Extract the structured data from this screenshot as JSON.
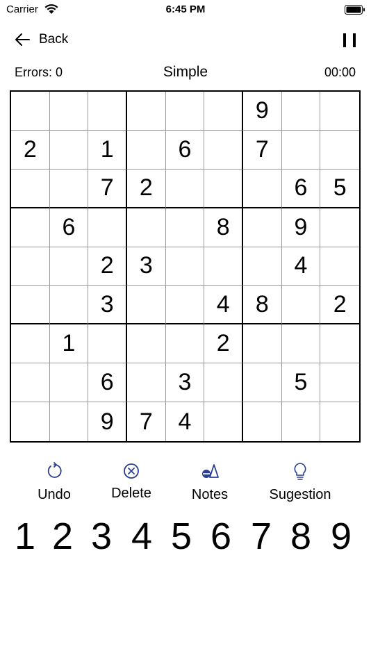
{
  "status": {
    "carrier": "Carrier",
    "time": "6:45 PM"
  },
  "nav": {
    "back_label": "Back"
  },
  "game": {
    "errors": "Errors: 0",
    "difficulty": "Simple",
    "timer": "00:00"
  },
  "board": [
    [
      "",
      "",
      "",
      "",
      "",
      "",
      "9",
      "",
      ""
    ],
    [
      "2",
      "",
      "1",
      "",
      "6",
      "",
      "7",
      "",
      ""
    ],
    [
      "",
      "",
      "7",
      "2",
      "",
      "",
      "",
      "6",
      "5"
    ],
    [
      "",
      "6",
      "",
      "",
      "",
      "8",
      "",
      "9",
      ""
    ],
    [
      "",
      "",
      "2",
      "3",
      "",
      "",
      "",
      "4",
      ""
    ],
    [
      "",
      "",
      "3",
      "",
      "",
      "4",
      "8",
      "",
      "2"
    ],
    [
      "",
      "1",
      "",
      "",
      "",
      "2",
      "",
      "",
      ""
    ],
    [
      "",
      "",
      "6",
      "",
      "3",
      "",
      "",
      "5",
      ""
    ],
    [
      "",
      "",
      "9",
      "7",
      "4",
      "",
      "",
      "",
      ""
    ]
  ],
  "tools": [
    {
      "label": "Undo",
      "icon": "undo-icon"
    },
    {
      "label": "Delete",
      "icon": "delete-icon"
    },
    {
      "label": "Notes",
      "icon": "notes-icon"
    },
    {
      "label": "Sugestion",
      "icon": "suggestion-icon"
    }
  ],
  "numpad": [
    "1",
    "2",
    "3",
    "4",
    "5",
    "6",
    "7",
    "8",
    "9"
  ],
  "colors": {
    "accent": "#2a3f8f",
    "grid_thin": "#999999",
    "grid_thick": "#000000"
  }
}
